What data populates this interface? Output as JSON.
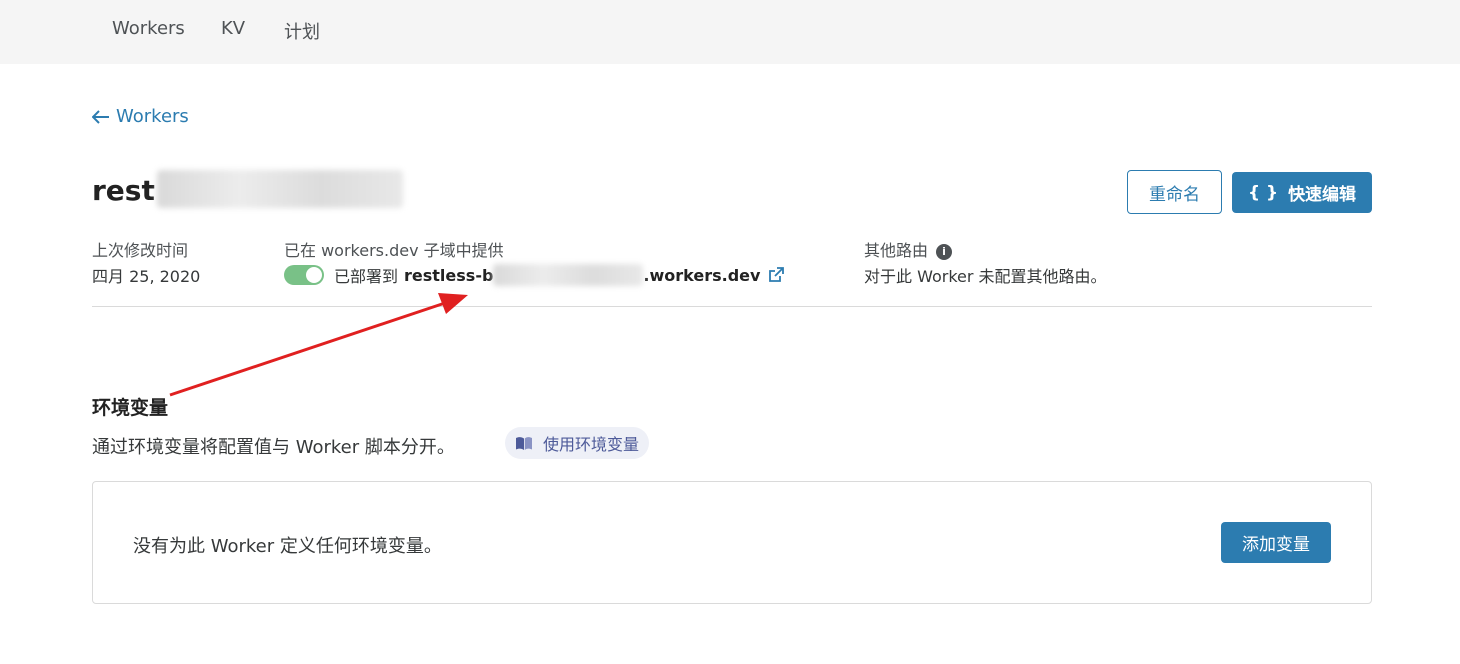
{
  "nav": {
    "tabs": [
      {
        "label": "Workers"
      },
      {
        "label": "KV"
      },
      {
        "label": "计划"
      }
    ]
  },
  "back": {
    "label": "Workers"
  },
  "worker": {
    "name_prefix": "rest"
  },
  "actions": {
    "rename_label": "重命名",
    "quick_edit_label": "快速编辑",
    "quick_edit_icon": "{ }"
  },
  "meta": {
    "modified_label": "上次修改时间",
    "modified_value": "四月 25, 2020",
    "subdomain_label": "已在 workers.dev 子域中提供",
    "deployed_prefix": "已部署到",
    "url_start": "restless-b",
    "url_end": ".workers.dev",
    "routes_label": "其他路由",
    "routes_value": "对于此 Worker 未配置其他路由。"
  },
  "env": {
    "title": "环境变量",
    "description": "通过环境变量将配置值与 Worker 脚本分开。",
    "doc_link": "使用环境变量",
    "empty_text": "没有为此 Worker 定义任何环境变量。",
    "add_label": "添加变量"
  },
  "colors": {
    "accent": "#2c7cb0",
    "toggle_on": "#79c187",
    "annotation_arrow": "#e02020"
  }
}
